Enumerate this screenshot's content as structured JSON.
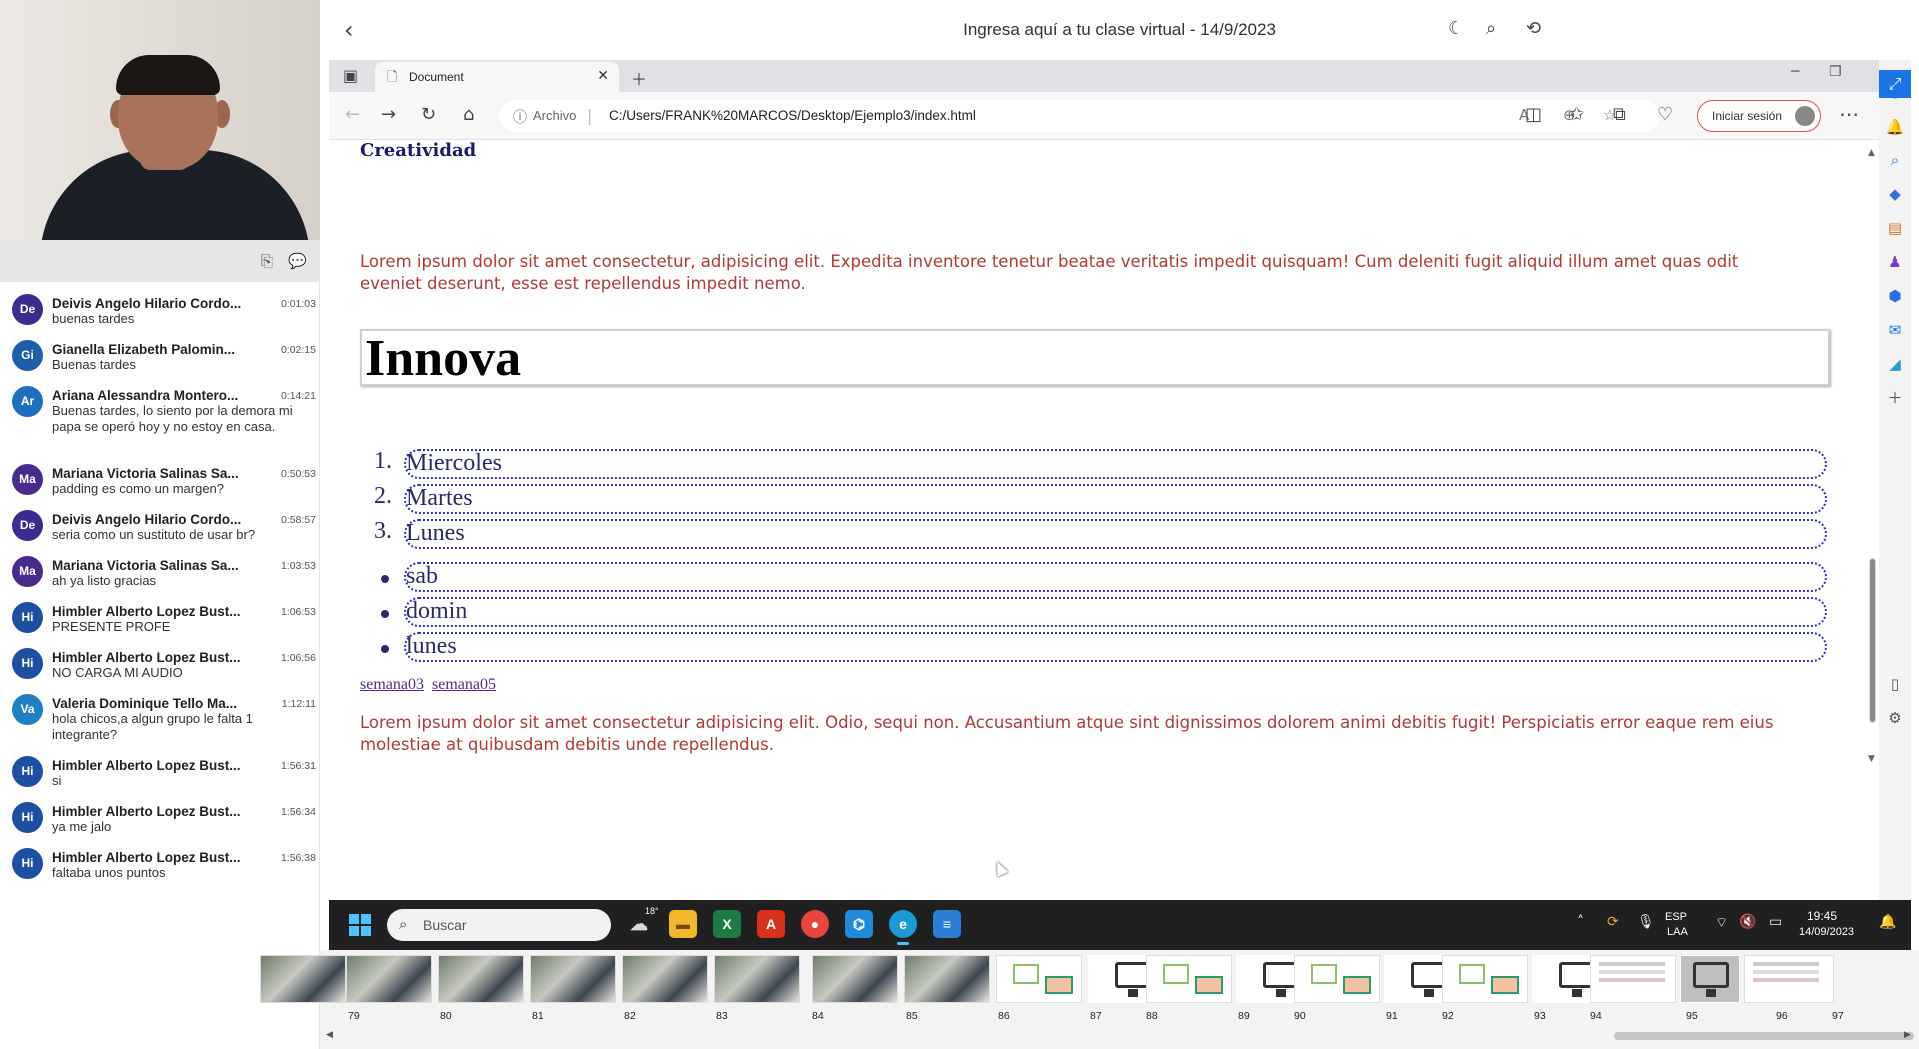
{
  "window": {
    "title": "Ingresa aquí a tu clase virtual - 14/9/2023"
  },
  "chat": {
    "messages": [
      {
        "initials": "De",
        "name": "Deivis Angelo Hilario Cordo...",
        "time": "0:01:03",
        "text": "buenas tardes",
        "color": "#3b2d8f"
      },
      {
        "initials": "Gi",
        "name": "Gianella Elizabeth Palomin...",
        "time": "0:02:15",
        "text": "Buenas tardes",
        "color": "#1f5fa8"
      },
      {
        "initials": "Ar",
        "name": "Ariana Alessandra Montero...",
        "time": "0:14:21",
        "text": "Buenas tardes, lo siento por la demora mi papa se operó hoy y no estoy en casa.",
        "color": "#1f6fbf"
      },
      {
        "initials": "Ma",
        "name": "Mariana Victoria Salinas Sa...",
        "time": "0:50:53",
        "text": "padding es como un margen?",
        "color": "#4a2b8c"
      },
      {
        "initials": "De",
        "name": "Deivis Angelo Hilario Cordo...",
        "time": "0:58:57",
        "text": "seria como un sustituto de usar br?",
        "color": "#3b2d8f"
      },
      {
        "initials": "Ma",
        "name": "Mariana Victoria Salinas Sa...",
        "time": "1:03:53",
        "text": "ah ya listo gracias",
        "color": "#4a2b8c"
      },
      {
        "initials": "Hi",
        "name": "Himbler Alberto Lopez Bust...",
        "time": "1:06:53",
        "text": "PRESENTE PROFE",
        "color": "#1f4fa0"
      },
      {
        "initials": "Hi",
        "name": "Himbler Alberto Lopez Bust...",
        "time": "1:06:56",
        "text": "NO CARGA MI AUDIO",
        "color": "#1f4fa0"
      },
      {
        "initials": "Va",
        "name": "Valeria Dominique Tello Ma...",
        "time": "1:12:11",
        "text": "hola chicos,a algun grupo le falta 1 integrante?",
        "color": "#1f7fc0"
      },
      {
        "initials": "Hi",
        "name": "Himbler Alberto Lopez Bust...",
        "time": "1:56:31",
        "text": "si",
        "color": "#1f4fa0"
      },
      {
        "initials": "Hi",
        "name": "Himbler Alberto Lopez Bust...",
        "time": "1:56:34",
        "text": "ya me jalo",
        "color": "#1f4fa0"
      },
      {
        "initials": "Hi",
        "name": "Himbler Alberto Lopez Bust...",
        "time": "1:56:38",
        "text": "faltaba unos puntos",
        "color": "#1f4fa0"
      }
    ]
  },
  "browser": {
    "tab_label": "Document",
    "address_prefix": "Archivo",
    "url": "C:/Users/FRANK%20MARCOS/Desktop/Ejemplo3/index.html",
    "signin_label": "Iniciar sesión"
  },
  "page": {
    "heading": "Creatividad",
    "lorem1": "Lorem ipsum dolor sit amet consectetur, adipisicing elit. Expedita inventore tenetur beatae veritatis impedit quisquam! Cum deleniti fugit aliquid illum amet quas odit eveniet deserunt, esse est repellendus impedit nemo.",
    "innova": "Innova",
    "ordered": [
      {
        "num": "1.",
        "label": "Miercoles"
      },
      {
        "num": "2.",
        "label": "Martes"
      },
      {
        "num": "3.",
        "label": "Lunes"
      }
    ],
    "unordered": [
      "sab",
      "domin",
      "lunes"
    ],
    "links": [
      "semana03",
      "semana05"
    ],
    "lorem2": "Lorem ipsum dolor sit amet consectetur adipisicing elit. Odio, sequi non. Accusantium atque sint dignissimos dolorem animi debitis fugit! Perspiciatis error eaque rem eius molestiae at quibusdam debitis unde repellendus."
  },
  "taskbar": {
    "search_placeholder": "Buscar",
    "weather_temp": "18°",
    "lang_1": "ESP",
    "lang_2": "LAA",
    "time": "19:45",
    "date": "14/09/2023"
  },
  "slides": {
    "numbers": [
      "79",
      "80",
      "81",
      "82",
      "83",
      "84",
      "85",
      "86",
      "87",
      "88",
      "89",
      "90",
      "91",
      "92",
      "93",
      "94",
      "95",
      "96",
      "97"
    ]
  }
}
